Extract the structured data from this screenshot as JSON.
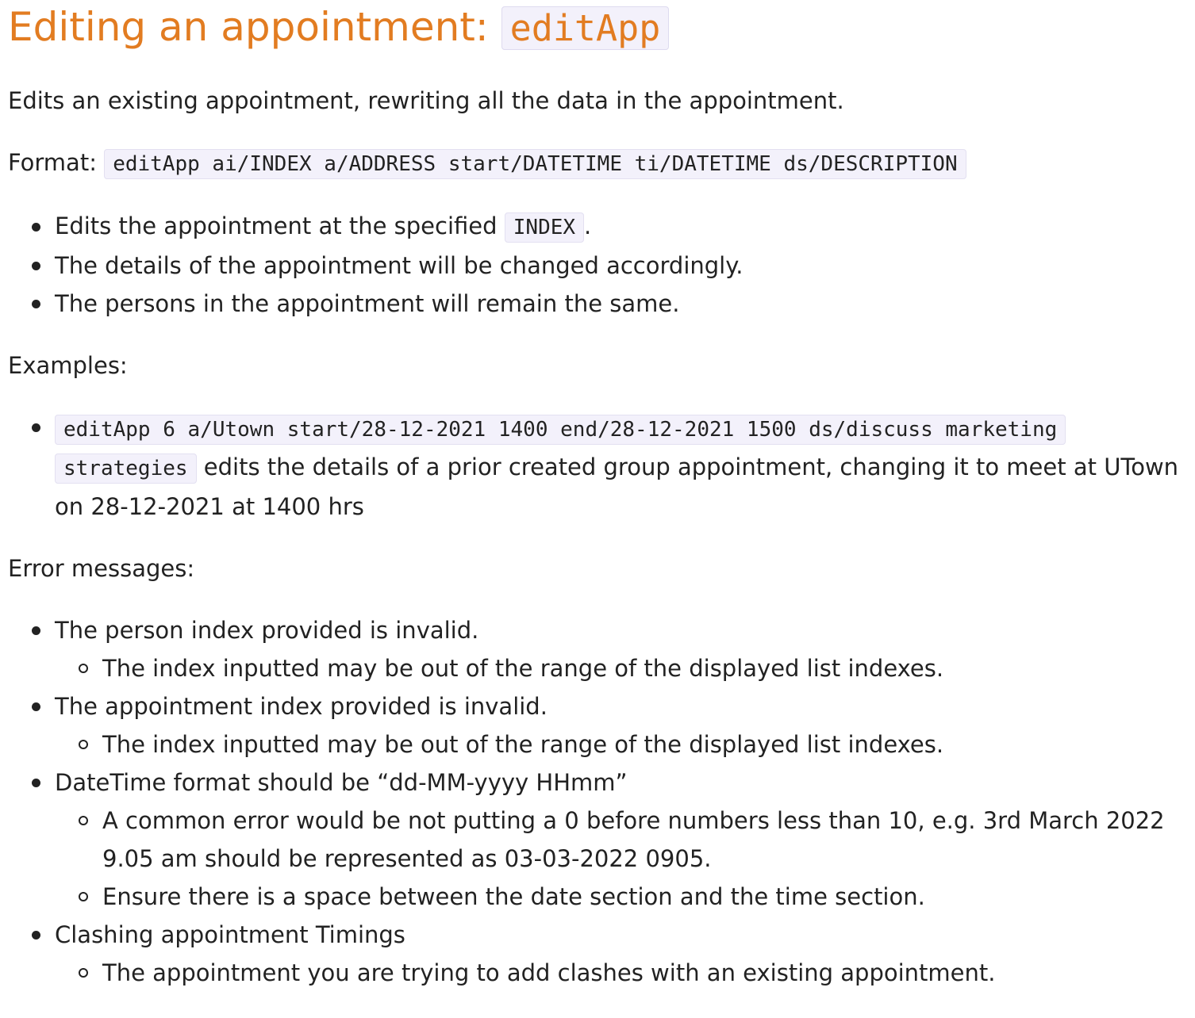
{
  "title": {
    "text": "Editing an appointment: ",
    "command": "editApp"
  },
  "intro": "Edits an existing appointment, rewriting all the data in the appointment.",
  "format": {
    "label": "Format: ",
    "code": "editApp ai/INDEX a/ADDRESS start/DATETIME ti/DATETIME ds/DESCRIPTION"
  },
  "details": {
    "item1_before": "Edits the appointment at the specified ",
    "item1_code": "INDEX",
    "item1_after": ".",
    "item2": "The details of the appointment will be changed accordingly.",
    "item3": "The persons in the appointment will remain the same."
  },
  "examples": {
    "heading": "Examples:",
    "code_line1": "editApp 6 a/Utown start/28-12-2021 1400 end/28-12-2021 1500 ds/discuss marketing",
    "code_line2": "strategies",
    "desc_line1": " edits the details of a prior created group appointment, changing it to meet at UTown",
    "desc_line2": "on 28-12-2021 at 1400 hrs"
  },
  "errors": {
    "heading": "Error messages:",
    "e1": "The person index provided is invalid.",
    "e1_sub": "The index inputted may be out of the range of the displayed list indexes.",
    "e2": "The appointment index provided is invalid.",
    "e2_sub": "The index inputted may be out of the range of the displayed list indexes.",
    "e3": "DateTime format should be “dd-MM-yyyy HHmm”",
    "e3_sub1_line1": "A common error would be not putting a 0 before numbers less than 10, e.g. 3rd March 2022",
    "e3_sub1_line2": "9.05 am should be represented as 03-03-2022 0905.",
    "e3_sub2": "Ensure there is a space between the date section and the time section.",
    "e4": "Clashing appointment Timings",
    "e4_sub": "The appointment you are trying to add clashes with an existing appointment."
  }
}
